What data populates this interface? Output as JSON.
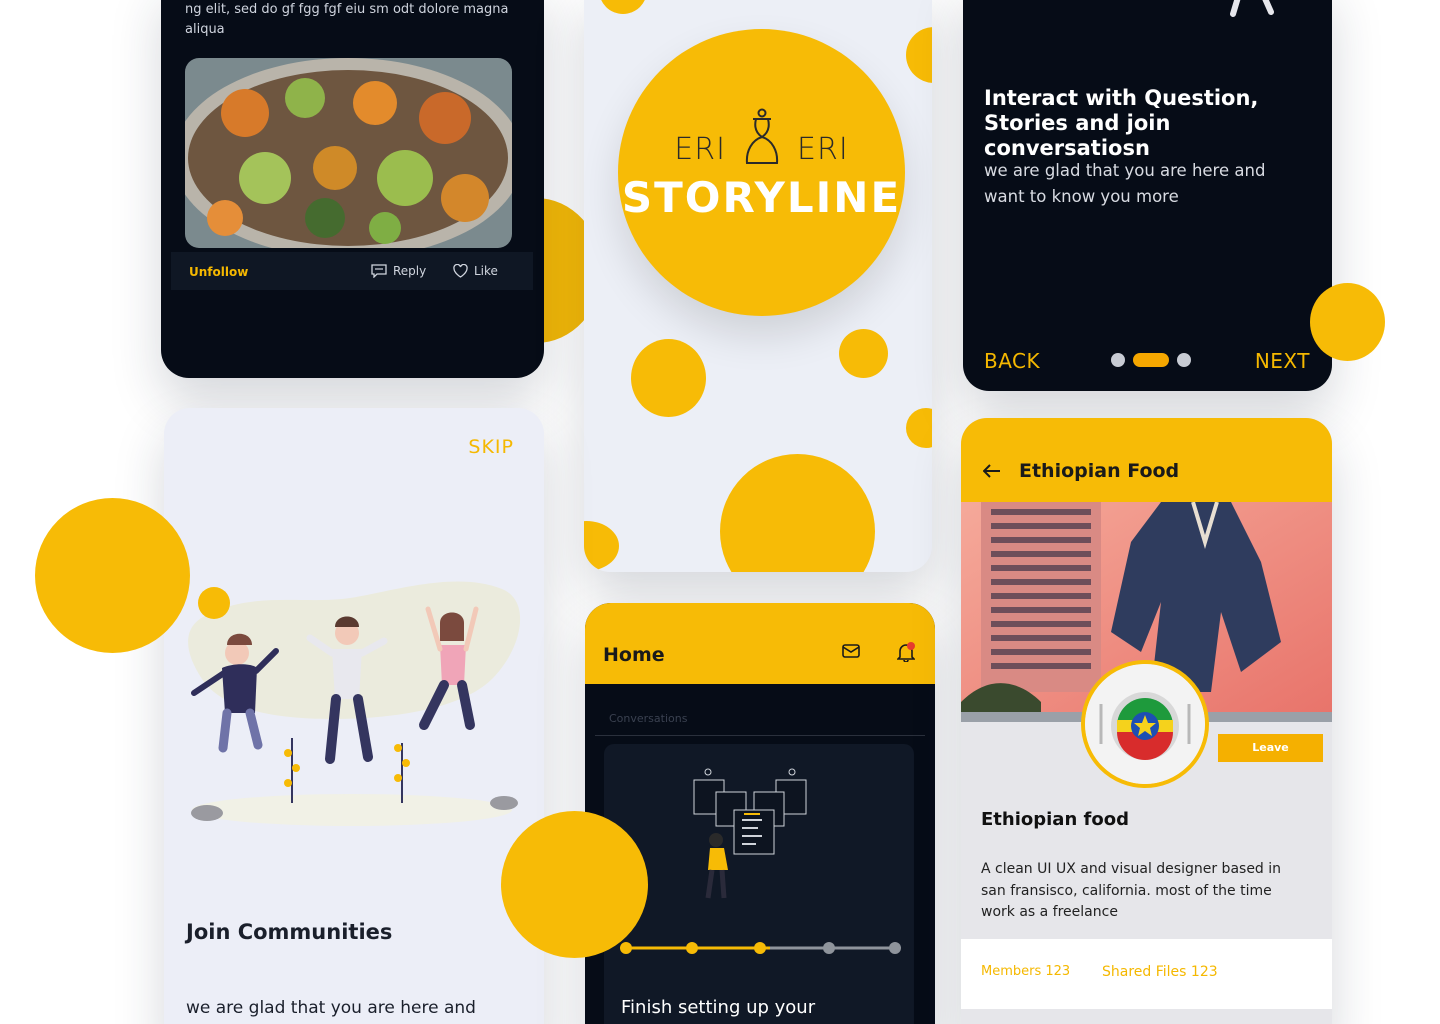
{
  "post": {
    "text": "Lorem ipsum dolor sit amet, conse ctetu radi pis ci ng elit, sed do gf fgg fgf eiu sm odt dolore magna aliqua",
    "unfollow_label": "Unfollow",
    "reply_label": "Reply",
    "like_label": "Like"
  },
  "splash": {
    "brand_left": "ERI",
    "brand_right": "ERI",
    "title": "STORYLINE"
  },
  "onboarding_interact": {
    "title": "Interact with Question, Stories and join conversatiosn",
    "description": "we are glad that you are here and want to know you more",
    "back_label": "BACK",
    "next_label": "NEXT",
    "page_count": 3,
    "active_page": 2
  },
  "onboarding_join": {
    "skip_label": "SKIP",
    "heading": "Join Communities",
    "description": "we are glad that you are here and"
  },
  "home": {
    "title": "Home",
    "section_label": "Conversations",
    "setup_text": "Finish setting up your",
    "progress_steps": 5,
    "progress_completed": 3
  },
  "group": {
    "header_title": "Ethiopian Food",
    "leave_label": "Leave",
    "name": "Ethiopian food",
    "description": "A clean UI UX and visual designer based in san fransisco, california. most of the time work as a freelance",
    "members_label": "Members",
    "members_count": "123",
    "files_label": "Shared Files",
    "files_count": "123"
  },
  "colors": {
    "accent": "#f7bb06",
    "dark_bg": "#060c17",
    "light_bg": "#eceef6"
  },
  "icons": [
    "reply-icon",
    "heart-icon",
    "mail-icon",
    "bell-icon",
    "back-arrow-icon",
    "kettle-logo-icon"
  ]
}
